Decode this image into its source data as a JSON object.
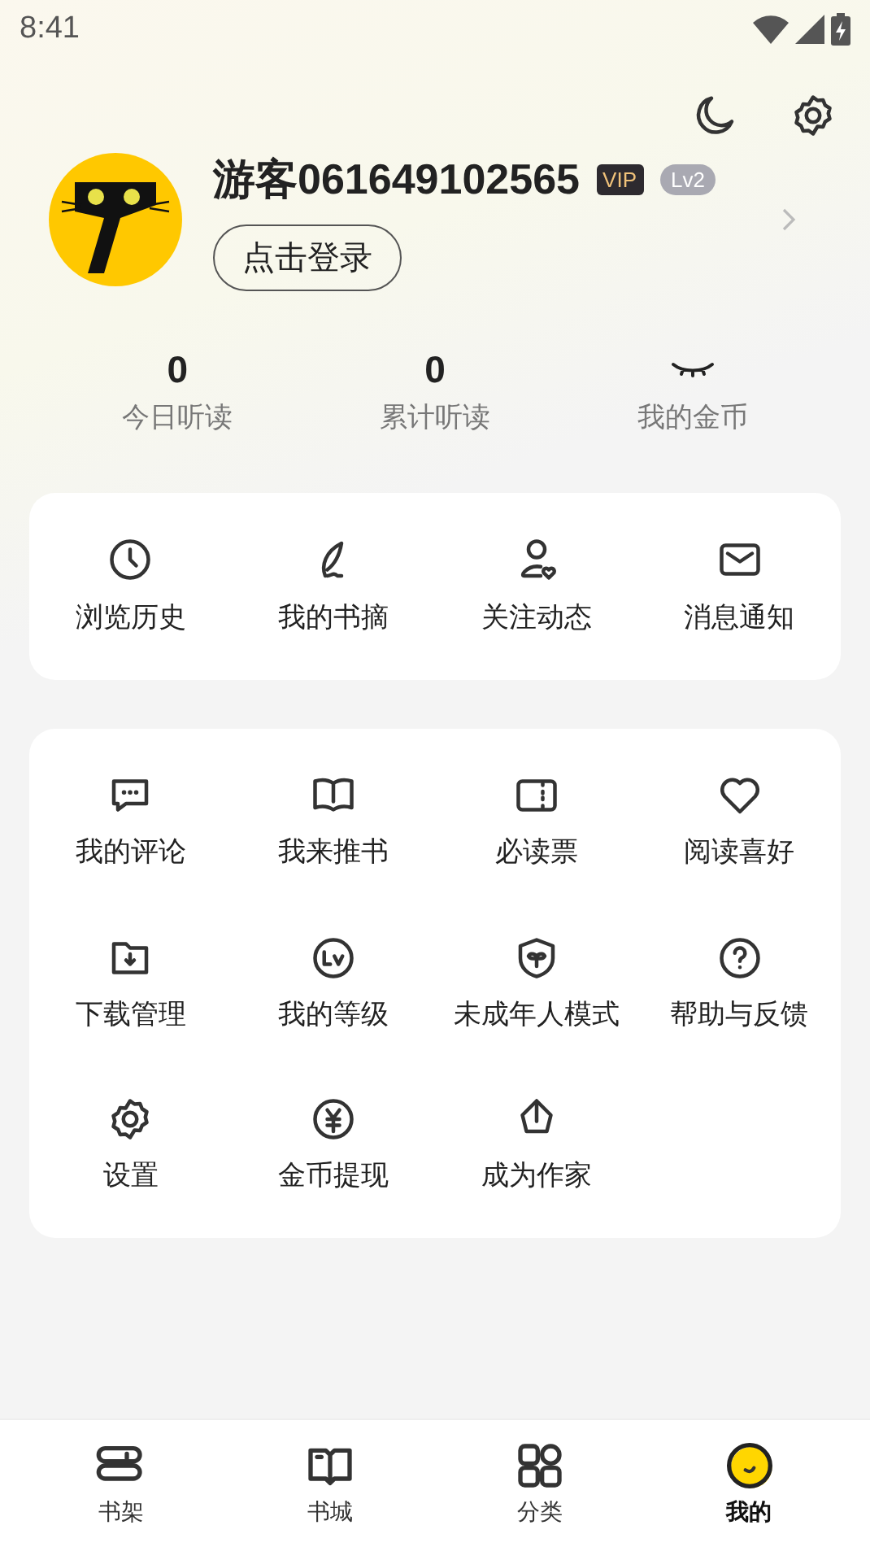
{
  "status_bar": {
    "time": "8:41"
  },
  "profile": {
    "name": "游客061649102565",
    "vip_badge": "VIP",
    "level_badge": "Lv2",
    "login_button": "点击登录"
  },
  "stats": [
    {
      "kind": "number",
      "value": "0",
      "label": "今日听读"
    },
    {
      "kind": "number",
      "value": "0",
      "label": "累计听读"
    },
    {
      "kind": "hidden",
      "label": "我的金币"
    }
  ],
  "quick_links": [
    "浏览历史",
    "我的书摘",
    "关注动态",
    "消息通知"
  ],
  "services": [
    "我的评论",
    "我来推书",
    "必读票",
    "阅读喜好",
    "下载管理",
    "我的等级",
    "未成年人模式",
    "帮助与反馈",
    "设置",
    "金币提现",
    "成为作家"
  ],
  "bottom_nav": [
    {
      "label": "书架",
      "selected": false
    },
    {
      "label": "书城",
      "selected": false
    },
    {
      "label": "分类",
      "selected": false
    },
    {
      "label": "我的",
      "selected": true
    }
  ]
}
